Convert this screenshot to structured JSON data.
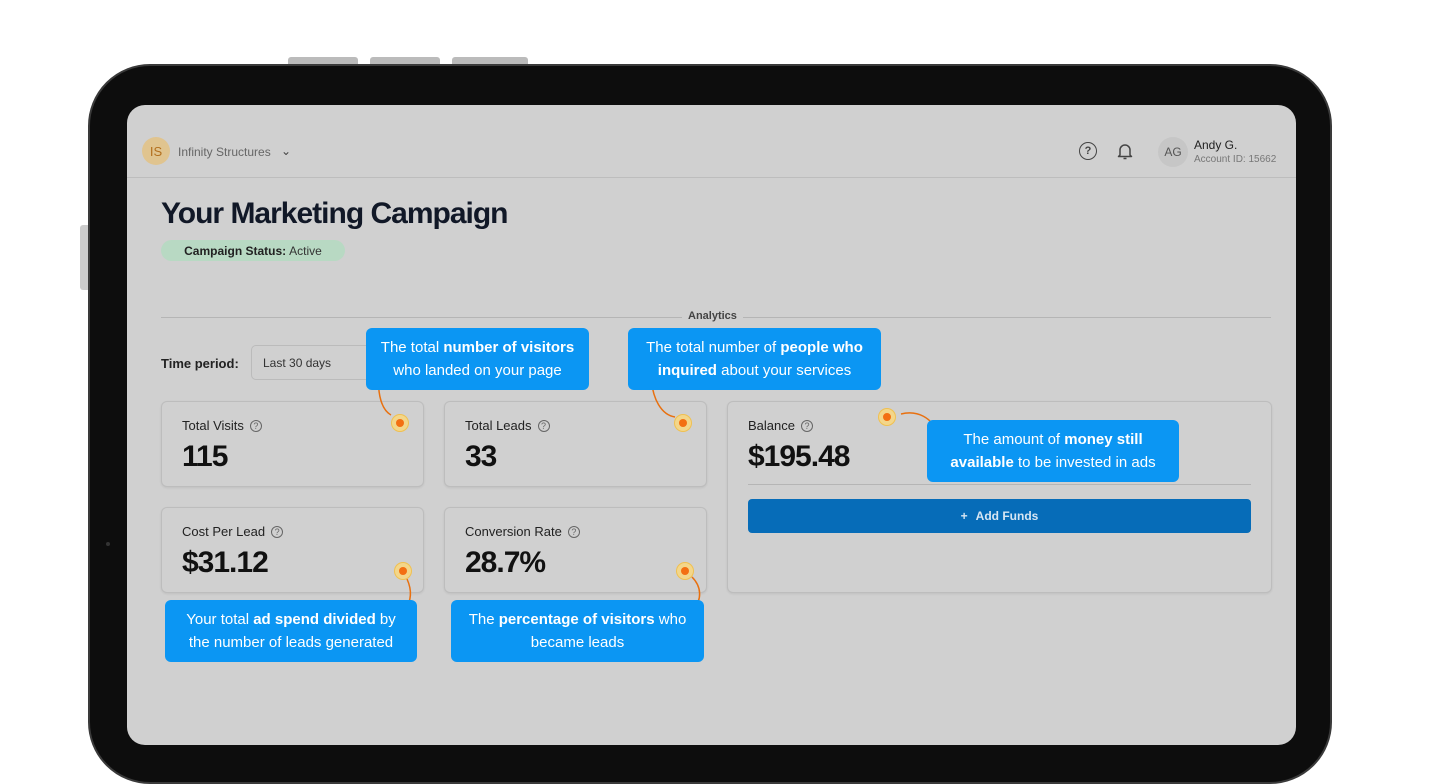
{
  "header": {
    "org_initials": "IS",
    "org_name": "Infinity Structures",
    "user_initials": "AG",
    "user_name": "Andy G.",
    "account_id": "Account ID: 15662"
  },
  "page": {
    "title": "Your Marketing Campaign",
    "status_label": "Campaign Status:",
    "status_value": "Active",
    "section": "Analytics",
    "time_period_label": "Time period:",
    "time_period_value": "Last 30 days"
  },
  "metrics": {
    "visits": {
      "label": "Total Visits",
      "value": "115"
    },
    "leads": {
      "label": "Total Leads",
      "value": "33"
    },
    "cpl": {
      "label": "Cost Per Lead",
      "value": "$31.12"
    },
    "conversion": {
      "label": "Conversion Rate",
      "value": "28.7%"
    },
    "balance": {
      "label": "Balance",
      "value": "$195.48"
    }
  },
  "add_funds_label": "Add Funds",
  "tips": {
    "visits": [
      "The total ",
      "number of visitors",
      " who landed on your page"
    ],
    "leads": [
      "The total number of ",
      "people who inquired",
      " about your services"
    ],
    "balance": [
      "The amount of ",
      "money still available",
      " to be invested in ads"
    ],
    "cpl": [
      "Your total ",
      "ad spend divided",
      " by the number of leads generated"
    ],
    "conversion": [
      "The ",
      "percentage of visitors",
      " who became leads"
    ]
  },
  "colors": {
    "accent": "#066cb8",
    "tooltip": "#0b96f3",
    "hotspot": "#f36f12"
  }
}
